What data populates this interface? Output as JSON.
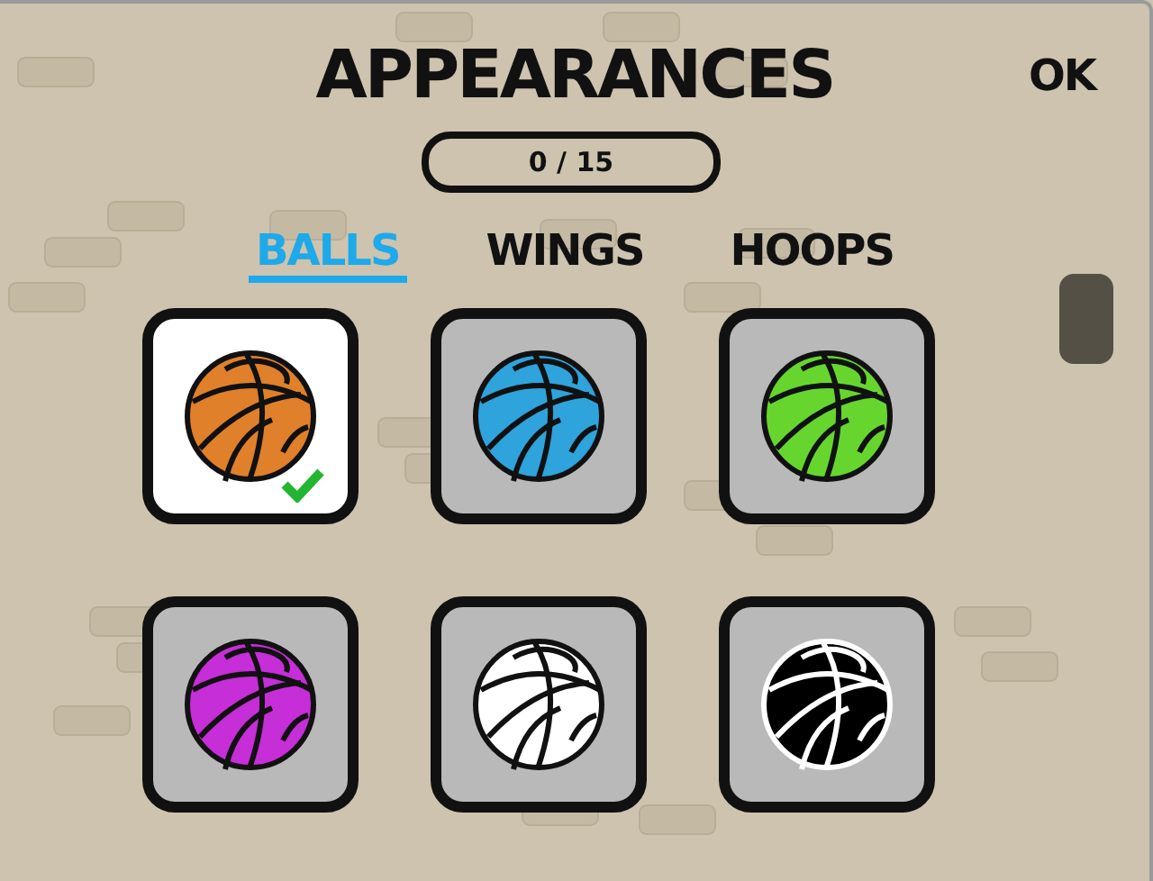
{
  "title": "APPEARANCES",
  "ok_button": "OK",
  "counter": "0 / 15",
  "tabs": [
    {
      "label": "BALLS",
      "selected": true
    },
    {
      "label": "WINGS",
      "selected": false
    },
    {
      "label": "HOOPS",
      "selected": false
    }
  ],
  "items": [
    {
      "color": "#e0802a",
      "kind": "dark-lines",
      "selected": true
    },
    {
      "color": "#2ea3dc",
      "kind": "dark-lines",
      "selected": false
    },
    {
      "color": "#66d62e",
      "kind": "dark-lines",
      "selected": false
    },
    {
      "color": "#c62ed8",
      "kind": "dark-lines",
      "selected": false
    },
    {
      "color": "#ffffff",
      "kind": "dark-lines",
      "selected": false
    },
    {
      "color": "#000000",
      "kind": "light-lines",
      "selected": false
    }
  ]
}
